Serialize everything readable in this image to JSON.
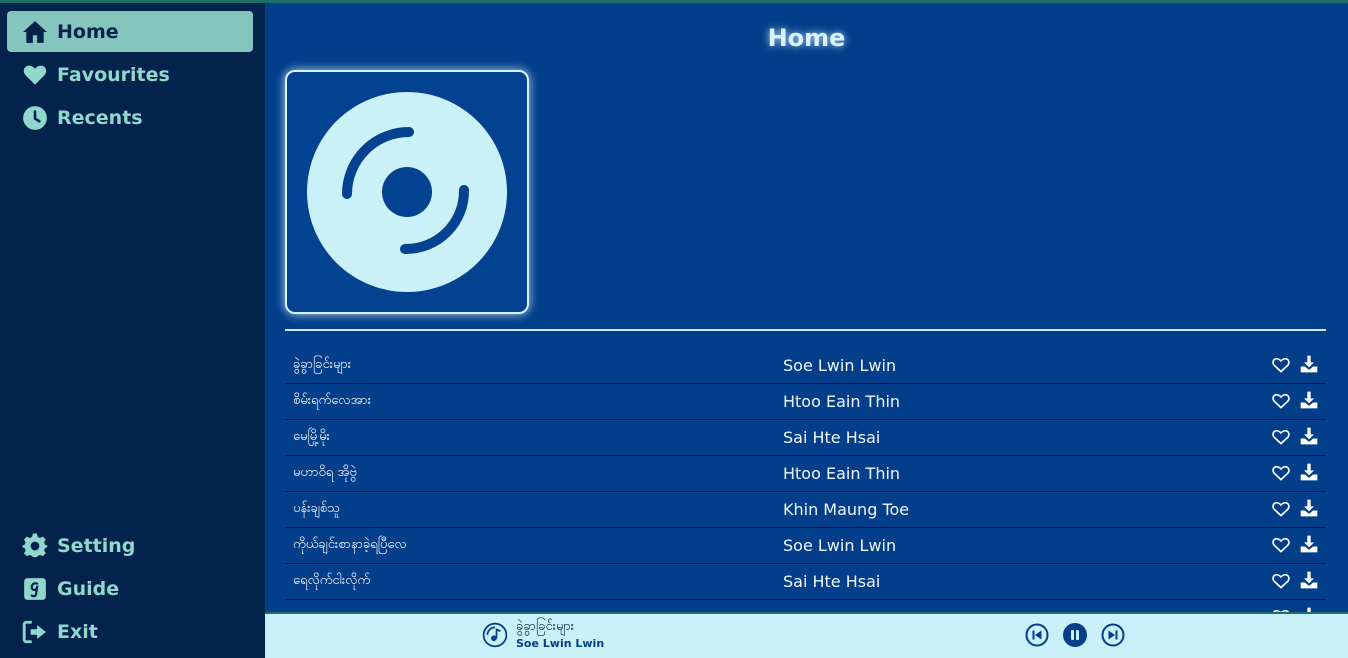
{
  "colors": {
    "sidebar_bg": "#03224c",
    "main_bg": "#023e8a",
    "accent": "#86c4be",
    "player_bg": "#caf0f8"
  },
  "sidebar": {
    "top_items": [
      {
        "label": "Home",
        "icon": "home-icon",
        "active": true
      },
      {
        "label": "Favourites",
        "icon": "heart-icon",
        "active": false
      },
      {
        "label": "Recents",
        "icon": "clock-icon",
        "active": false
      }
    ],
    "bottom_items": [
      {
        "label": "Setting",
        "icon": "gear-icon"
      },
      {
        "label": "Guide",
        "icon": "guide-icon"
      },
      {
        "label": "Exit",
        "icon": "exit-icon"
      }
    ]
  },
  "main": {
    "title": "Home",
    "cover_icon": "disc-icon",
    "tracks": [
      {
        "title": "ခွဲခွာခြင်းများ",
        "artist": "Soe Lwin Lwin"
      },
      {
        "title": "စိမ်းရက်လေအား",
        "artist": "Htoo Eain Thin"
      },
      {
        "title": "မေမြို့မိုး",
        "artist": "Sai Hte Hsai"
      },
      {
        "title": "မဟာဝိရ အိုဗွဲ",
        "artist": "Htoo Eain Thin"
      },
      {
        "title": "ပန်းချစ်သူ",
        "artist": "Khin Maung Toe"
      },
      {
        "title": "ကိုယ်ချင်းစာနာခဲ့ရပြီလေ",
        "artist": "Soe Lwin Lwin"
      },
      {
        "title": "ရေလိုက်ငါးလိုက်",
        "artist": "Sai Hte Hsai"
      }
    ]
  },
  "player": {
    "title": "ခွဲခွာခြင်းများ",
    "artist": "Soe Lwin Lwin",
    "state": "playing",
    "icons": [
      "music-disc-icon",
      "previous-icon",
      "pause-icon",
      "next-icon"
    ]
  }
}
